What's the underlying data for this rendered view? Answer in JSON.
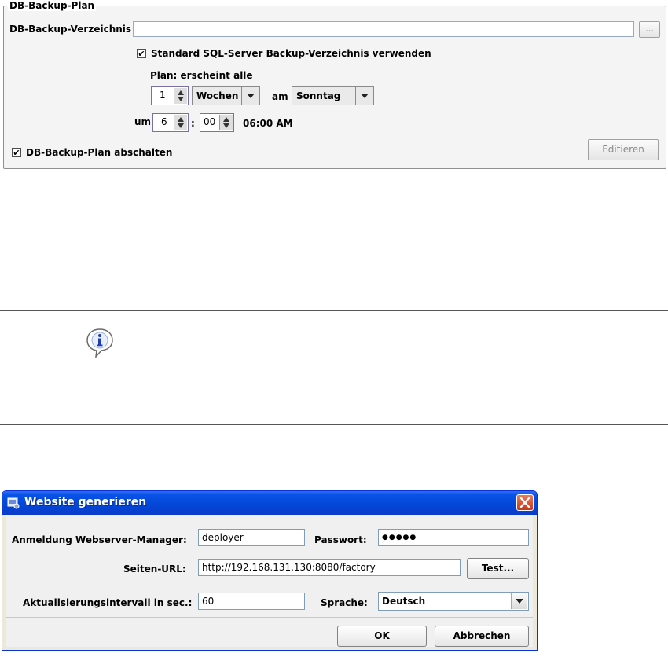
{
  "backup_plan": {
    "legend": "DB-Backup-Plan",
    "dir_label": "DB-Backup-Verzeichnis",
    "dir_value": "",
    "browse_label": "...",
    "standard_dir_checkbox": {
      "label": "Standard SQL-Server Backup-Verzeichnis verwenden",
      "checked": true,
      "mark": "✔"
    },
    "plan_label": "Plan: erscheint alle",
    "interval_value": "1",
    "interval_unit": "Wochen",
    "am_label": "am",
    "weekday": "Sonntag",
    "um_label": "um",
    "hour_value": "6",
    "colon": ":",
    "minute_value": "00",
    "time_display": "06:00 AM",
    "disable_checkbox": {
      "label": "DB-Backup-Plan abschalten",
      "checked": true,
      "mark": "✔"
    },
    "edit_button": "Editieren"
  },
  "info_panel": {
    "icon": "info-icon"
  },
  "dialog": {
    "title": "Website generieren",
    "login_label": "Anmeldung Webserver-Manager:",
    "login_value": "deployer",
    "password_label": "Passwort:",
    "password_value": "●●●●●",
    "url_label": "Seiten-URL:",
    "url_value": "http://192.168.131.130:8080/factory",
    "test_button": "Test...",
    "interval_label": "Aktualisierungsintervall in sec.:",
    "interval_value": "60",
    "language_label": "Sprache:",
    "language_value": "Deutsch",
    "ok_button": "OK",
    "cancel_button": "Abbrechen"
  },
  "colors": {
    "titlebar": "#0a52e6",
    "close": "#c5381b",
    "panel_bg": "#f4f4f4",
    "dialog_bg": "#ece9d8"
  }
}
